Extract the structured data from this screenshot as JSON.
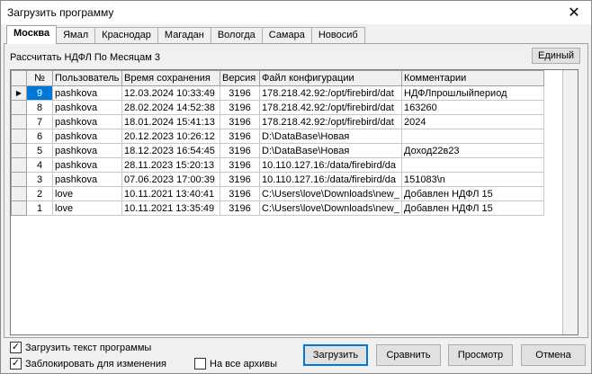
{
  "window": {
    "title": "Загрузить программу"
  },
  "tabs": [
    "Москва",
    "Ямал",
    "Краснодар",
    "Магадан",
    "Вологда",
    "Самара",
    "Новосиб"
  ],
  "header": {
    "subtitle": "Рассчитать НДФЛ По Месяцам 3",
    "single_label": "Единый"
  },
  "table": {
    "columns": [
      "№",
      "Пользователь",
      "Время сохранения",
      "Версия",
      "Файл конфигурации",
      "Комментарии"
    ],
    "rows": [
      [
        "9",
        "pashkova",
        "12.03.2024 10:33:49",
        "3196",
        "178.218.42.92:/opt/firebird/dat",
        "НДФЛпрошлыйпериод"
      ],
      [
        "8",
        "pashkova",
        "28.02.2024 14:52:38",
        "3196",
        "178.218.42.92:/opt/firebird/dat",
        "163260"
      ],
      [
        "7",
        "pashkova",
        "18.01.2024 15:41:13",
        "3196",
        "178.218.42.92:/opt/firebird/dat",
        "2024"
      ],
      [
        "6",
        "pashkova",
        "20.12.2023 10:26:12",
        "3196",
        "D:\\DataBase\\Новая",
        ""
      ],
      [
        "5",
        "pashkova",
        "18.12.2023 16:54:45",
        "3196",
        "D:\\DataBase\\Новая",
        "Доход22в23"
      ],
      [
        "4",
        "pashkova",
        "28.11.2023 15:20:13",
        "3196",
        "10.110.127.16:/data/firebird/da",
        ""
      ],
      [
        "3",
        "pashkova",
        "07.06.2023 17:00:39",
        "3196",
        "10.110.127.16:/data/firebird/da",
        "151083\\n"
      ],
      [
        "2",
        "love",
        "10.11.2021 13:40:41",
        "3196",
        "C:\\Users\\love\\Downloads\\new_",
        "Добавлен НДФЛ 15"
      ],
      [
        "1",
        "love",
        "10.11.2021 13:35:49",
        "3196",
        "C:\\Users\\love\\Downloads\\new_",
        "Добавлен НДФЛ 15"
      ]
    ]
  },
  "options": {
    "load_text": "Загрузить текст программы",
    "lock_changes": "Заблокировать для изменения",
    "all_archives": "На все архивы"
  },
  "buttons": {
    "load": "Загрузить",
    "compare": "Сравнить",
    "view": "Просмотр",
    "cancel": "Отмена"
  },
  "colors": {
    "selection": "#0078d7",
    "default_border": "#0078d7"
  }
}
